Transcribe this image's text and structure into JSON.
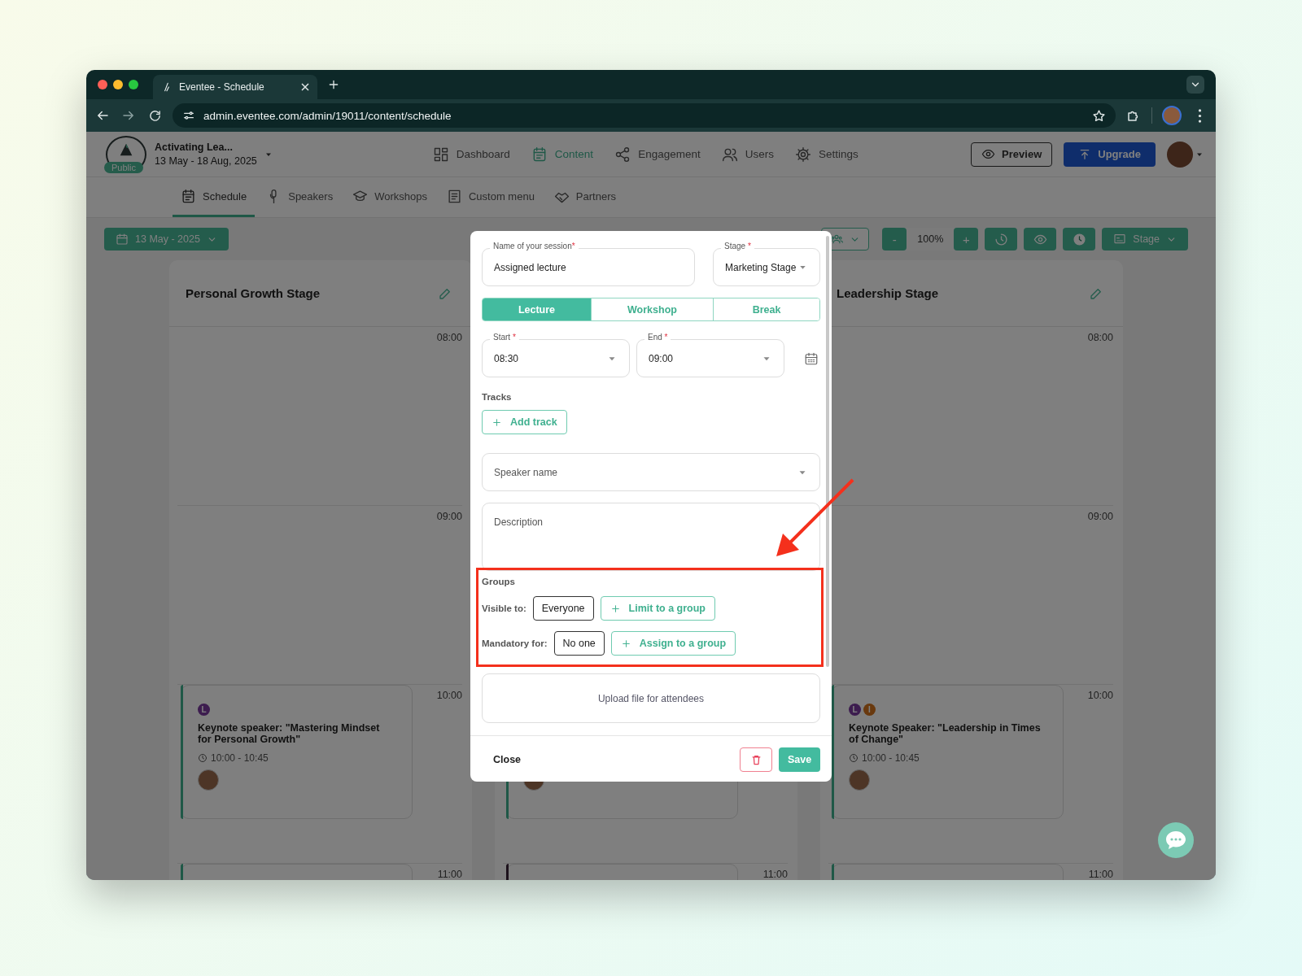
{
  "browser": {
    "tab_title": "Eventee - Schedule",
    "url": "admin.eventee.com/admin/19011/content/schedule"
  },
  "event": {
    "badge": "Public",
    "name": "Activating Lea...",
    "dates": "13 May - 18 Aug, 2025"
  },
  "main_nav": [
    {
      "label": "Dashboard",
      "selected": false
    },
    {
      "label": "Content",
      "selected": true
    },
    {
      "label": "Engagement",
      "selected": false
    },
    {
      "label": "Users",
      "selected": false
    },
    {
      "label": "Settings",
      "selected": false
    }
  ],
  "header_buttons": {
    "preview": "Preview",
    "upgrade": "Upgrade"
  },
  "sub_nav": [
    {
      "label": "Schedule",
      "selected": true
    },
    {
      "label": "Speakers",
      "selected": false
    },
    {
      "label": "Workshops",
      "selected": false
    },
    {
      "label": "Custom menu",
      "selected": false
    },
    {
      "label": "Partners",
      "selected": false
    }
  ],
  "toolbar": {
    "date": "13 May - 2025",
    "zoom_out": "-",
    "zoom": "100%",
    "zoom_in": "+",
    "view": "Stage"
  },
  "stages": [
    {
      "name": "Personal Growth Stage",
      "rows": [
        {
          "time": "08:00"
        },
        {
          "time": "09:00"
        },
        {
          "time": "10:00",
          "session": {
            "color": "#1f5847",
            "tags": [
              {
                "letter": "L",
                "color": "#3d1d4f"
              }
            ],
            "title": "Keynote speaker: \"Mastering Mindset for Personal Growth\"",
            "time": "10:00 - 10:45",
            "speaker_avatar": true
          }
        },
        {
          "time": "11:00",
          "session": {
            "color": "#1f5847"
          }
        }
      ]
    },
    {
      "rows": [
        {},
        {},
        {
          "session": {
            "color": "#1f5847",
            "speaker_avatar": true
          }
        },
        {
          "time": "11:00",
          "session": {
            "color": "#1d121c"
          }
        }
      ]
    },
    {
      "name": "Leadership Stage",
      "rows": [
        {
          "time": "08:00"
        },
        {
          "time": "09:00"
        },
        {
          "time": "10:00",
          "session": {
            "color": "#1f5847",
            "tags": [
              {
                "letter": "L",
                "color": "#3d1d4f"
              },
              {
                "letter": "I",
                "color": "#69390e"
              }
            ],
            "title": "Keynote Speaker: \"Leadership in Times of Change\"",
            "time": "10:00 - 10:45",
            "speaker_avatar": true
          }
        },
        {
          "time": "11:00",
          "session": {
            "color": "#1f5847"
          }
        }
      ]
    }
  ],
  "session_dialog": {
    "name_field": {
      "label": "Name of your session",
      "required_mark": "*",
      "value": "Assigned lecture"
    },
    "stage_field": {
      "label": "Stage",
      "required_mark": "*",
      "value": "Marketing Stage"
    },
    "type_tabs": [
      {
        "label": "Lecture",
        "selected": true
      },
      {
        "label": "Workshop",
        "selected": false
      },
      {
        "label": "Break",
        "selected": false
      }
    ],
    "start_field": {
      "label": "Start",
      "required_mark": "*",
      "value": "08:30"
    },
    "end_field": {
      "label": "End",
      "required_mark": "*",
      "value": "09:00"
    },
    "tracks": {
      "label": "Tracks",
      "add_button": "Add track"
    },
    "speaker_field": {
      "placeholder": "Speaker name"
    },
    "description_field": {
      "placeholder": "Description"
    },
    "groups": {
      "title": "Groups",
      "visible_label": "Visible to:",
      "visible_value": "Everyone",
      "visible_button": "Limit to a group",
      "mandatory_label": "Mandatory for:",
      "mandatory_value": "No one",
      "mandatory_button": "Assign to a group"
    },
    "upload": "Upload file for attendees",
    "close": "Close",
    "save": "Save"
  }
}
